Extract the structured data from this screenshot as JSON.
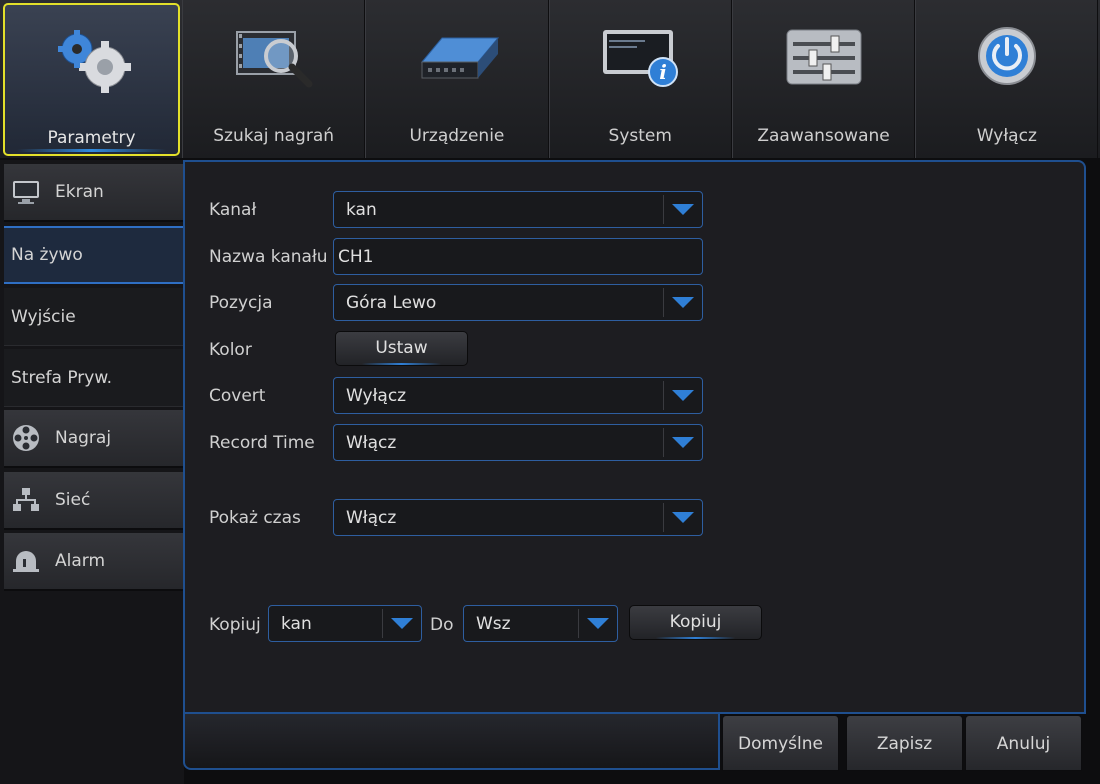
{
  "tabs": [
    {
      "label": "Parametry",
      "icon": "gears-icon",
      "active": true
    },
    {
      "label": "Szukaj nagrań",
      "icon": "film-search-icon"
    },
    {
      "label": "Urządzenie",
      "icon": "hard-drive-icon"
    },
    {
      "label": "System",
      "icon": "monitor-info-icon"
    },
    {
      "label": "Zaawansowane",
      "icon": "sliders-icon"
    },
    {
      "label": "Wyłącz",
      "icon": "power-icon"
    }
  ],
  "sidebar": {
    "ekran": "Ekran",
    "na_zywo": "Na żywo",
    "wyjscie": "Wyjście",
    "strefa": "Strefa Pryw.",
    "nagraj": "Nagraj",
    "siec": "Sieć",
    "alarm": "Alarm"
  },
  "form": {
    "kanal_label": "Kanał",
    "kanal_value": "kan",
    "nazwa_label": "Nazwa kanału",
    "nazwa_value": "CH1",
    "pozycja_label": "Pozycja",
    "pozycja_value": "Góra Lewo",
    "kolor_label": "Kolor",
    "kolor_button": "Ustaw",
    "covert_label": "Covert",
    "covert_value": "Wyłącz",
    "record_label": "Record Time",
    "record_value": "Włącz",
    "pokaz_label": "Pokaż czas",
    "pokaz_value": "Włącz"
  },
  "copy": {
    "label": "Kopiuj",
    "from_value": "kan",
    "to_label": "Do",
    "to_value": "Wsz",
    "button": "Kopiuj"
  },
  "footer": {
    "default": "Domyślne",
    "save": "Zapisz",
    "cancel": "Anuluj"
  },
  "colors": {
    "accent": "#2f7fd6",
    "active_tab_border": "#e3e02a",
    "panel_border": "#1f4f8f"
  }
}
